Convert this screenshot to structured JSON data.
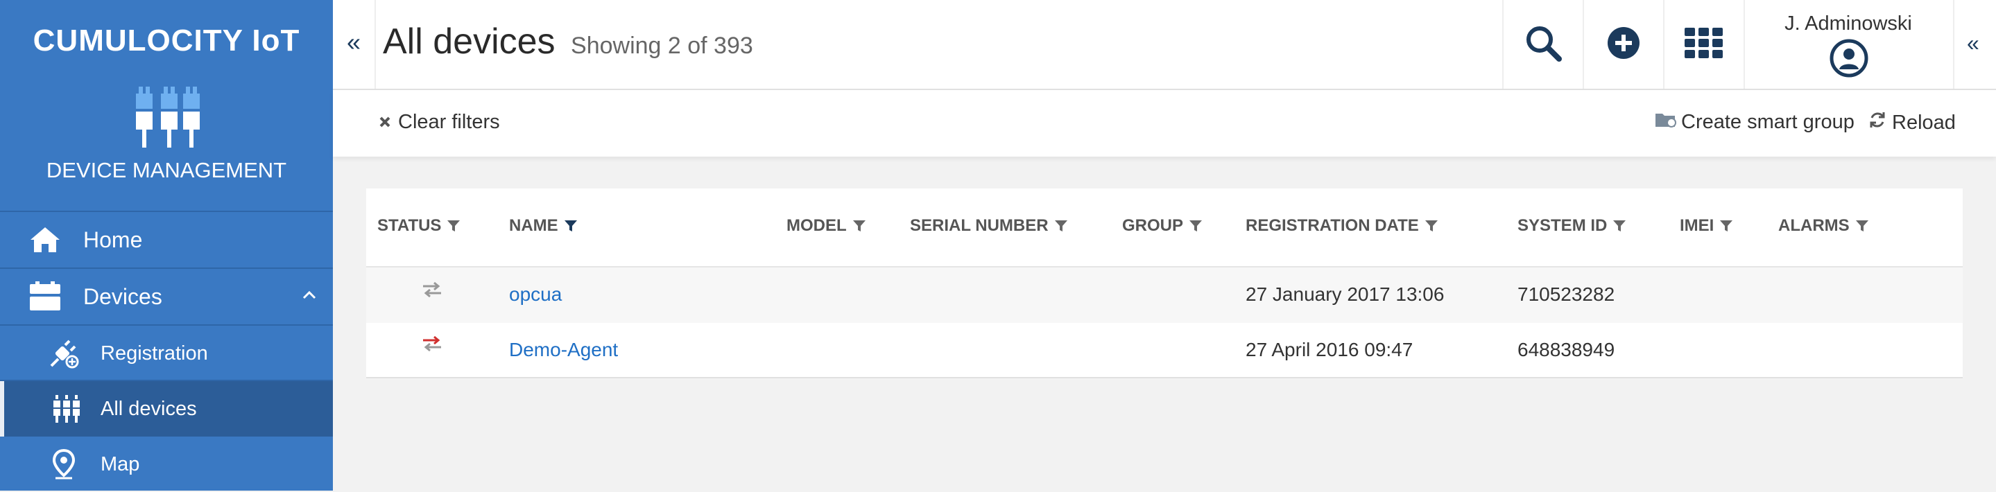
{
  "brand": {
    "title": "CUMULOCITY IoT",
    "subtitle": "DEVICE MANAGEMENT",
    "color": "#3a79c3"
  },
  "sidebar": {
    "home": {
      "label": "Home",
      "icon": "home-icon"
    },
    "devices": {
      "label": "Devices",
      "icon": "devices-icon"
    },
    "registration": {
      "label": "Registration",
      "icon": "plug-icon"
    },
    "all_devices": {
      "label": "All devices",
      "icon": "devices-grid-icon"
    },
    "map": {
      "label": "Map",
      "icon": "map-marker-icon"
    }
  },
  "header": {
    "title": "All devices",
    "subtitle": "Showing 2 of 393",
    "user_name": "J. Adminowski"
  },
  "actions": {
    "clear_filters": "Clear filters",
    "create_smart_group": "Create smart group",
    "reload": "Reload"
  },
  "table": {
    "columns": [
      "STATUS",
      "NAME",
      "MODEL",
      "SERIAL NUMBER",
      "GROUP",
      "REGISTRATION DATE",
      "SYSTEM ID",
      "IMEI",
      "ALARMS"
    ],
    "rows": [
      {
        "status": "connection-unknown",
        "name": "opcua",
        "model": "",
        "serial": "",
        "group": "",
        "registration_date": "27 January 2017 13:06",
        "system_id": "710523282",
        "imei": "",
        "alarms": ""
      },
      {
        "status": "connection-error",
        "name": "Demo-Agent",
        "model": "",
        "serial": "",
        "group": "",
        "registration_date": "27 April 2016 09:47",
        "system_id": "648838949",
        "imei": "",
        "alarms": ""
      }
    ]
  },
  "colors": {
    "link": "#1f6fc5",
    "status_error": "#d0302f",
    "status_unknown": "#999999"
  }
}
